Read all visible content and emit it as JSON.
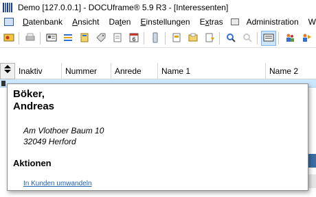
{
  "window": {
    "title": "Demo [127.0.0.1] - DOCUframe® 5.9 R3 - [Interessenten]"
  },
  "menu": {
    "items": [
      {
        "label": "Datenbank",
        "accel": "D"
      },
      {
        "label": "Ansicht",
        "accel": "A"
      },
      {
        "label": "Daten",
        "accel": "t"
      },
      {
        "label": "Einstellungen",
        "accel": "E"
      },
      {
        "label": "Extras",
        "accel": "x"
      },
      {
        "label": "Administration",
        "accel": ""
      },
      {
        "label": "W",
        "accel": ""
      }
    ]
  },
  "toolbar": {
    "buttons": [
      {
        "icon": "contacts-icon"
      },
      {
        "icon": "print-icon"
      },
      {
        "icon": "card-icon"
      },
      {
        "icon": "list-icon"
      },
      {
        "icon": "folder-icon"
      },
      {
        "icon": "tag-icon"
      },
      {
        "icon": "document-icon"
      },
      {
        "icon": "calendar-icon",
        "text": "6"
      },
      {
        "icon": "phone-icon"
      },
      {
        "icon": "new-document-icon"
      },
      {
        "icon": "open-document-icon"
      },
      {
        "icon": "export-document-icon"
      },
      {
        "icon": "search-icon"
      },
      {
        "icon": "search-disabled-icon"
      },
      {
        "icon": "view-card-icon",
        "active": true
      },
      {
        "icon": "users-icon"
      },
      {
        "icon": "user-transfer-icon"
      }
    ]
  },
  "grid": {
    "columns": [
      "Inaktiv",
      "Nummer",
      "Anrede",
      "Name 1",
      "Name 2"
    ],
    "sort_icon": "sort-updown-icon"
  },
  "popup": {
    "name_line1": "Böker,",
    "name_line2": "Andreas",
    "street": "Am Vlothoer Baum 10",
    "city": "32049 Herford",
    "section_title": "Aktionen",
    "action_link": "In Kunden umwandeln"
  },
  "colors": {
    "selected_row": "#cce8ff",
    "link": "#1a5fb4",
    "accent_blue": "#3a6ea5"
  }
}
